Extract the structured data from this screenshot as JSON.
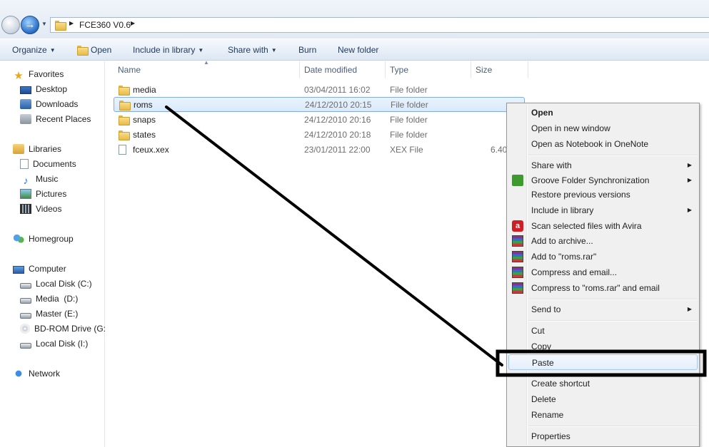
{
  "address_bar": {
    "path": "FCE360 V0.6"
  },
  "toolbar": {
    "organize": "Organize",
    "open": "Open",
    "include": "Include in library",
    "share": "Share with",
    "burn": "Burn",
    "new_folder": "New folder"
  },
  "nav": {
    "favorites": "Favorites",
    "desktop": "Desktop",
    "downloads": "Downloads",
    "recent": "Recent Places",
    "libraries": "Libraries",
    "documents": "Documents",
    "music": "Music",
    "pictures": "Pictures",
    "videos": "Videos",
    "homegroup": "Homegroup",
    "computer": "Computer",
    "disk_c": "Local Disk (C:)",
    "disk_d": "Media  (D:)",
    "disk_e": "Master (E:)",
    "disk_g": "BD-ROM Drive (G:",
    "disk_i": "Local Disk (I:)",
    "network": "Network"
  },
  "columns": {
    "name": "Name",
    "date": "Date modified",
    "type": "Type",
    "size": "Size"
  },
  "files": [
    {
      "name": "media",
      "date": "03/04/2011 16:02",
      "type": "File folder",
      "size": ""
    },
    {
      "name": "roms",
      "date": "24/12/2010 20:15",
      "type": "File folder",
      "size": ""
    },
    {
      "name": "snaps",
      "date": "24/12/2010 20:16",
      "type": "File folder",
      "size": ""
    },
    {
      "name": "states",
      "date": "24/12/2010 20:18",
      "type": "File folder",
      "size": ""
    },
    {
      "name": "fceux.xex",
      "date": "23/01/2011 22:00",
      "type": "XEX File",
      "size": "6.40"
    }
  ],
  "menu": {
    "open": "Open",
    "open_new_window": "Open in new window",
    "open_onenote": "Open as Notebook in OneNote",
    "share_with": "Share with",
    "groove": "Groove Folder Synchronization",
    "restore": "Restore previous versions",
    "include": "Include in library",
    "avira": "Scan selected files with Avira",
    "add_archive": "Add to archive...",
    "add_roms_rar": "Add to \"roms.rar\"",
    "compress_email": "Compress and email...",
    "compress_roms_email": "Compress to \"roms.rar\" and email",
    "send_to": "Send to",
    "cut": "Cut",
    "copy": "Copy",
    "paste": "Paste",
    "create_shortcut": "Create shortcut",
    "delete": "Delete",
    "rename": "Rename",
    "properties": "Properties"
  }
}
